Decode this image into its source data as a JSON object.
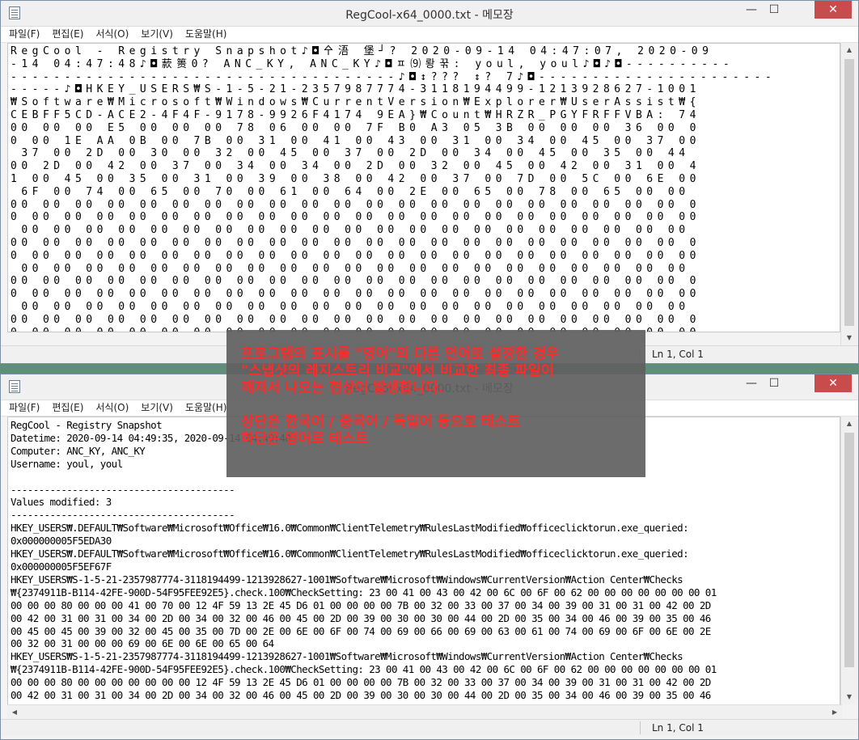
{
  "colors": {
    "overlay_text": "#ff2a2a",
    "close_button": "#c94c4c"
  },
  "top_window": {
    "title": "RegCool-x64_0000.txt - 메모장",
    "status": "Ln 1, Col 1",
    "body_lines": [
      "RegCool - Registry Snapshot♪◘㐃浯 堡┘? 2020-09-14 04:47:07, 2020-09",
      "-14 04:47:48♪◘䕀篑0? ANC_KY, ANC_KY♪◘ㅍ⑼뢍꾺: youl, youl♪◘♪◘----------",
      "------------------------------------♪◘↕??? ↕? 7♪◘----------------------",
      "-----♪◘HKEY_USERS₩S-1-5-21-2357987774-3118194499-1213928627-1001",
      "₩Software₩Microsoft₩Windows₩CurrentVersion₩Explorer₩UserAssist₩{",
      "CEBFF5CD-ACE2-4F4F-9178-9926F4174 9EA}₩Count₩HRZR_PGYFRFFVBA: 74",
      "00 00 00 E5 00 00 00 78 06 00 00 7F B0 A3 05 3B 00 00 00 36 00 0",
      "0 00 1E AA 0B 00 7B 00 31 00 41 00 43 00 31 00 34 00 45 00 37 00",
      " 37 00 2D 00 30 00 32 00 45 00 37 00 2D 00 34 00 45 00 35 00 44",
      "00 2D 00 42 00 37 00 34 00 34 00 2D 00 32 00 45 00 42 00 31 00 4",
      "1 00 45 00 35 00 31 00 39 00 38 00 42 00 37 00 7D 00 5C 00 6E 00",
      " 6F 00 74 00 65 00 70 00 61 00 64 00 2E 00 65 00 78 00 65 00 00",
      "00 00 00 00 00 00 00 00 00 00 00 00 00 00 00 00 00 00 00 00 00 0",
      "0 00 00 00 00 00 00 00 00 00 00 00 00 00 00 00 00 00 00 00 00 00",
      " 00 00 00 00 00 00 00 00 00 00 00 00 00 00 00 00 00 00 00 00 00",
      "00 00 00 00 00 00 00 00 00 00 00 00 00 00 00 00 00 00 00 00 00 0",
      "0 00 00 00 00 00 00 00 00 00 00 00 00 00 00 00 00 00 00 00 00 00",
      " 00 00 00 00 00 00 00 00 00 00 00 00 00 00 00 00 00 00 00 00 00",
      "00 00 00 00 00 00 00 00 00 00 00 00 00 00 00 00 00 00 00 00 00 0",
      "0 00 00 00 00 00 00 00 00 00 00 00 00 00 00 00 00 00 00 00 00 00",
      " 00 00 00 00 00 00 00 00 00 00 00 00 00 00 00 00 00 00 00 00 00",
      "00 00 00 00 00 00 00 00 00 00 00 00 00 00 00 00 00 00 00 00 00 0",
      "0 00 00 00 00 00 00 00 00 00 00 00 00 00 00 00 00 00 00 00 00 00",
      " 00 00 00 00 00 00 00 00 00 00 00 00 00 00 00 00 00 00 00 00 00"
    ]
  },
  "bottom_window": {
    "title": "RegCool-x64_0000.txt - 메모장",
    "status": "Ln 1, Col 1",
    "body_lines": [
      "RegCool - Registry Snapshot",
      "Datetime: 2020-09-14 04:49:35, 2020-09-14 04:49:48",
      "Computer: ANC_KY, ANC_KY",
      "Username: youl, youl",
      "",
      "----------------------------------------",
      "Values modified: 3",
      "----------------------------------------",
      "HKEY_USERS₩.DEFAULT₩Software₩Microsoft₩Office₩16.0₩Common₩ClientTelemetry₩RulesLastModified₩officeclicktorun.exe_queried:",
      "0x000000005F5EDA30",
      "HKEY_USERS₩.DEFAULT₩Software₩Microsoft₩Office₩16.0₩Common₩ClientTelemetry₩RulesLastModified₩officeclicktorun.exe_queried:",
      "0x000000005F5EF67F",
      "HKEY_USERS₩S-1-5-21-2357987774-3118194499-1213928627-1001₩Software₩Microsoft₩Windows₩CurrentVersion₩Action Center₩Checks",
      "₩{2374911B-B114-42FE-900D-54F95FEE92E5}.check.100₩CheckSetting: 23 00 41 00 43 00 42 00 6C 00 6F 00 62 00 00 00 00 00 00 00 01",
      "00 00 00 80 00 00 00 41 00 70 00 12 4F 59 13 2E 45 D6 01 00 00 00 00 7B 00 32 00 33 00 37 00 34 00 39 00 31 00 31 00 42 00 2D",
      "00 42 00 31 00 31 00 34 00 2D 00 34 00 32 00 46 00 45 00 2D 00 39 00 30 00 30 00 44 00 2D 00 35 00 34 00 46 00 39 00 35 00 46",
      "00 45 00 45 00 39 00 32 00 45 00 35 00 7D 00 2E 00 6E 00 6F 00 74 00 69 00 66 00 69 00 63 00 61 00 74 00 69 00 6F 00 6E 00 2E",
      "00 32 00 31 00 00 00 69 00 6E 00 6E 00 65 00 64",
      "HKEY_USERS₩S-1-5-21-2357987774-3118194499-1213928627-1001₩Software₩Microsoft₩Windows₩CurrentVersion₩Action Center₩Checks",
      "₩{2374911B-B114-42FE-900D-54F95FEE92E5}.check.100₩CheckSetting: 23 00 41 00 43 00 42 00 6C 00 6F 00 62 00 00 00 00 00 00 00 01",
      "00 00 00 80 00 00 00 00 00 00 00 12 4F 59 13 2E 45 D6 01 00 00 00 00 7B 00 32 00 33 00 37 00 34 00 39 00 31 00 31 00 42 00 2D",
      "00 42 00 31 00 31 00 34 00 2D 00 34 00 32 00 46 00 45 00 2D 00 39 00 30 00 30 00 44 00 2D 00 35 00 34 00 46 00 39 00 35 00 46"
    ]
  },
  "menu": {
    "file": "파일(F)",
    "edit": "편집(E)",
    "format": "서식(O)",
    "view": "보기(V)",
    "help": "도움말(H)"
  },
  "window_controls": {
    "minimize": "—",
    "maximize": "☐",
    "close": "✕"
  },
  "overlay": {
    "line1": "프로그램의 표시를 \"영어\"외 다른 언어로 설정한 경우",
    "line2": "\"스냅샷의 레지스트리 비교\"에서 비교한 최종 파일이",
    "line3": "깨져서 나오는 현상이 발생합니다.",
    "line4": "상단은 한국어 / 중국어 / 독일어 등으로 테스트",
    "line5": "하단은 영어로 테스트"
  }
}
